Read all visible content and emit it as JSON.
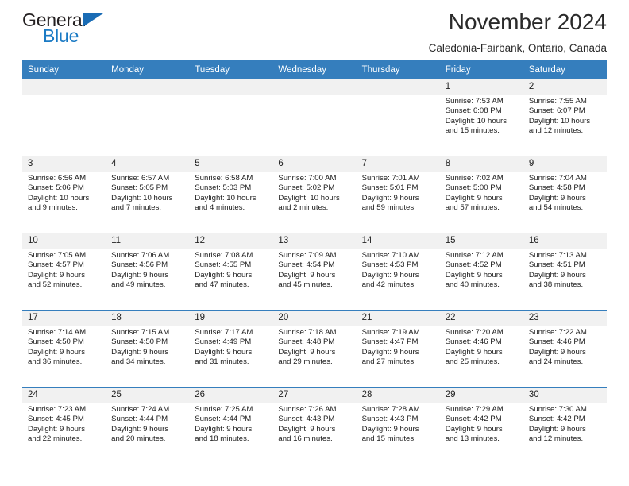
{
  "brand": {
    "name_part1": "General",
    "name_part2": "Blue",
    "accent_color": "#1a7ac4",
    "triangle_icon": "brand-triangle-icon"
  },
  "header": {
    "title": "November 2024",
    "subtitle": "Caledonia-Fairbank, Ontario, Canada"
  },
  "calendar": {
    "header_bg": "#357ebd",
    "datenum_bg": "#f1f1f1",
    "weekdays": [
      "Sunday",
      "Monday",
      "Tuesday",
      "Wednesday",
      "Thursday",
      "Friday",
      "Saturday"
    ],
    "weeks": [
      {
        "days": [
          {
            "date": "",
            "sunrise": "",
            "sunset": "",
            "daylight_line1": "",
            "daylight_line2": ""
          },
          {
            "date": "",
            "sunrise": "",
            "sunset": "",
            "daylight_line1": "",
            "daylight_line2": ""
          },
          {
            "date": "",
            "sunrise": "",
            "sunset": "",
            "daylight_line1": "",
            "daylight_line2": ""
          },
          {
            "date": "",
            "sunrise": "",
            "sunset": "",
            "daylight_line1": "",
            "daylight_line2": ""
          },
          {
            "date": "",
            "sunrise": "",
            "sunset": "",
            "daylight_line1": "",
            "daylight_line2": ""
          },
          {
            "date": "1",
            "sunrise": "Sunrise: 7:53 AM",
            "sunset": "Sunset: 6:08 PM",
            "daylight_line1": "Daylight: 10 hours",
            "daylight_line2": "and 15 minutes."
          },
          {
            "date": "2",
            "sunrise": "Sunrise: 7:55 AM",
            "sunset": "Sunset: 6:07 PM",
            "daylight_line1": "Daylight: 10 hours",
            "daylight_line2": "and 12 minutes."
          }
        ]
      },
      {
        "days": [
          {
            "date": "3",
            "sunrise": "Sunrise: 6:56 AM",
            "sunset": "Sunset: 5:06 PM",
            "daylight_line1": "Daylight: 10 hours",
            "daylight_line2": "and 9 minutes."
          },
          {
            "date": "4",
            "sunrise": "Sunrise: 6:57 AM",
            "sunset": "Sunset: 5:05 PM",
            "daylight_line1": "Daylight: 10 hours",
            "daylight_line2": "and 7 minutes."
          },
          {
            "date": "5",
            "sunrise": "Sunrise: 6:58 AM",
            "sunset": "Sunset: 5:03 PM",
            "daylight_line1": "Daylight: 10 hours",
            "daylight_line2": "and 4 minutes."
          },
          {
            "date": "6",
            "sunrise": "Sunrise: 7:00 AM",
            "sunset": "Sunset: 5:02 PM",
            "daylight_line1": "Daylight: 10 hours",
            "daylight_line2": "and 2 minutes."
          },
          {
            "date": "7",
            "sunrise": "Sunrise: 7:01 AM",
            "sunset": "Sunset: 5:01 PM",
            "daylight_line1": "Daylight: 9 hours",
            "daylight_line2": "and 59 minutes."
          },
          {
            "date": "8",
            "sunrise": "Sunrise: 7:02 AM",
            "sunset": "Sunset: 5:00 PM",
            "daylight_line1": "Daylight: 9 hours",
            "daylight_line2": "and 57 minutes."
          },
          {
            "date": "9",
            "sunrise": "Sunrise: 7:04 AM",
            "sunset": "Sunset: 4:58 PM",
            "daylight_line1": "Daylight: 9 hours",
            "daylight_line2": "and 54 minutes."
          }
        ]
      },
      {
        "days": [
          {
            "date": "10",
            "sunrise": "Sunrise: 7:05 AM",
            "sunset": "Sunset: 4:57 PM",
            "daylight_line1": "Daylight: 9 hours",
            "daylight_line2": "and 52 minutes."
          },
          {
            "date": "11",
            "sunrise": "Sunrise: 7:06 AM",
            "sunset": "Sunset: 4:56 PM",
            "daylight_line1": "Daylight: 9 hours",
            "daylight_line2": "and 49 minutes."
          },
          {
            "date": "12",
            "sunrise": "Sunrise: 7:08 AM",
            "sunset": "Sunset: 4:55 PM",
            "daylight_line1": "Daylight: 9 hours",
            "daylight_line2": "and 47 minutes."
          },
          {
            "date": "13",
            "sunrise": "Sunrise: 7:09 AM",
            "sunset": "Sunset: 4:54 PM",
            "daylight_line1": "Daylight: 9 hours",
            "daylight_line2": "and 45 minutes."
          },
          {
            "date": "14",
            "sunrise": "Sunrise: 7:10 AM",
            "sunset": "Sunset: 4:53 PM",
            "daylight_line1": "Daylight: 9 hours",
            "daylight_line2": "and 42 minutes."
          },
          {
            "date": "15",
            "sunrise": "Sunrise: 7:12 AM",
            "sunset": "Sunset: 4:52 PM",
            "daylight_line1": "Daylight: 9 hours",
            "daylight_line2": "and 40 minutes."
          },
          {
            "date": "16",
            "sunrise": "Sunrise: 7:13 AM",
            "sunset": "Sunset: 4:51 PM",
            "daylight_line1": "Daylight: 9 hours",
            "daylight_line2": "and 38 minutes."
          }
        ]
      },
      {
        "days": [
          {
            "date": "17",
            "sunrise": "Sunrise: 7:14 AM",
            "sunset": "Sunset: 4:50 PM",
            "daylight_line1": "Daylight: 9 hours",
            "daylight_line2": "and 36 minutes."
          },
          {
            "date": "18",
            "sunrise": "Sunrise: 7:15 AM",
            "sunset": "Sunset: 4:50 PM",
            "daylight_line1": "Daylight: 9 hours",
            "daylight_line2": "and 34 minutes."
          },
          {
            "date": "19",
            "sunrise": "Sunrise: 7:17 AM",
            "sunset": "Sunset: 4:49 PM",
            "daylight_line1": "Daylight: 9 hours",
            "daylight_line2": "and 31 minutes."
          },
          {
            "date": "20",
            "sunrise": "Sunrise: 7:18 AM",
            "sunset": "Sunset: 4:48 PM",
            "daylight_line1": "Daylight: 9 hours",
            "daylight_line2": "and 29 minutes."
          },
          {
            "date": "21",
            "sunrise": "Sunrise: 7:19 AM",
            "sunset": "Sunset: 4:47 PM",
            "daylight_line1": "Daylight: 9 hours",
            "daylight_line2": "and 27 minutes."
          },
          {
            "date": "22",
            "sunrise": "Sunrise: 7:20 AM",
            "sunset": "Sunset: 4:46 PM",
            "daylight_line1": "Daylight: 9 hours",
            "daylight_line2": "and 25 minutes."
          },
          {
            "date": "23",
            "sunrise": "Sunrise: 7:22 AM",
            "sunset": "Sunset: 4:46 PM",
            "daylight_line1": "Daylight: 9 hours",
            "daylight_line2": "and 24 minutes."
          }
        ]
      },
      {
        "days": [
          {
            "date": "24",
            "sunrise": "Sunrise: 7:23 AM",
            "sunset": "Sunset: 4:45 PM",
            "daylight_line1": "Daylight: 9 hours",
            "daylight_line2": "and 22 minutes."
          },
          {
            "date": "25",
            "sunrise": "Sunrise: 7:24 AM",
            "sunset": "Sunset: 4:44 PM",
            "daylight_line1": "Daylight: 9 hours",
            "daylight_line2": "and 20 minutes."
          },
          {
            "date": "26",
            "sunrise": "Sunrise: 7:25 AM",
            "sunset": "Sunset: 4:44 PM",
            "daylight_line1": "Daylight: 9 hours",
            "daylight_line2": "and 18 minutes."
          },
          {
            "date": "27",
            "sunrise": "Sunrise: 7:26 AM",
            "sunset": "Sunset: 4:43 PM",
            "daylight_line1": "Daylight: 9 hours",
            "daylight_line2": "and 16 minutes."
          },
          {
            "date": "28",
            "sunrise": "Sunrise: 7:28 AM",
            "sunset": "Sunset: 4:43 PM",
            "daylight_line1": "Daylight: 9 hours",
            "daylight_line2": "and 15 minutes."
          },
          {
            "date": "29",
            "sunrise": "Sunrise: 7:29 AM",
            "sunset": "Sunset: 4:42 PM",
            "daylight_line1": "Daylight: 9 hours",
            "daylight_line2": "and 13 minutes."
          },
          {
            "date": "30",
            "sunrise": "Sunrise: 7:30 AM",
            "sunset": "Sunset: 4:42 PM",
            "daylight_line1": "Daylight: 9 hours",
            "daylight_line2": "and 12 minutes."
          }
        ]
      }
    ]
  }
}
